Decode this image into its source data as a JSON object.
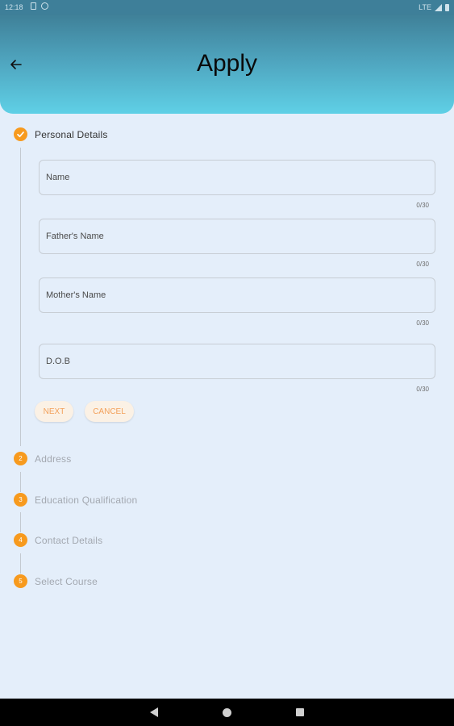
{
  "status_bar": {
    "time": "12:18",
    "network": "LTE"
  },
  "header": {
    "title": "Apply"
  },
  "steps": [
    {
      "number": "1",
      "label": "Personal Details",
      "state": "completed"
    },
    {
      "number": "2",
      "label": "Address",
      "state": "pending"
    },
    {
      "number": "3",
      "label": "Education Qualification",
      "state": "pending"
    },
    {
      "number": "4",
      "label": "Contact Details",
      "state": "pending"
    },
    {
      "number": "5",
      "label": "Select Course",
      "state": "pending"
    }
  ],
  "fields": [
    {
      "label": "Name",
      "value": "",
      "counter": "0/30"
    },
    {
      "label": "Father's Name",
      "value": "",
      "counter": "0/30"
    },
    {
      "label": "Mother's Name",
      "value": "",
      "counter": "0/30"
    },
    {
      "label": "D.O.B",
      "value": "",
      "counter": "0/30"
    }
  ],
  "buttons": {
    "next": "NEXT",
    "cancel": "CANCEL"
  },
  "icons": {
    "back": "arrow-left-icon",
    "step_done": "check-icon",
    "nav_back": "triangle-back-icon",
    "nav_home": "circle-home-icon",
    "nav_recents": "square-recents-icon"
  },
  "colors": {
    "header_top": "#3f8098",
    "header_bottom": "#5fd0e6",
    "accent": "#f79a1e",
    "background": "#e4eefa",
    "button_text": "#f3a05a"
  }
}
